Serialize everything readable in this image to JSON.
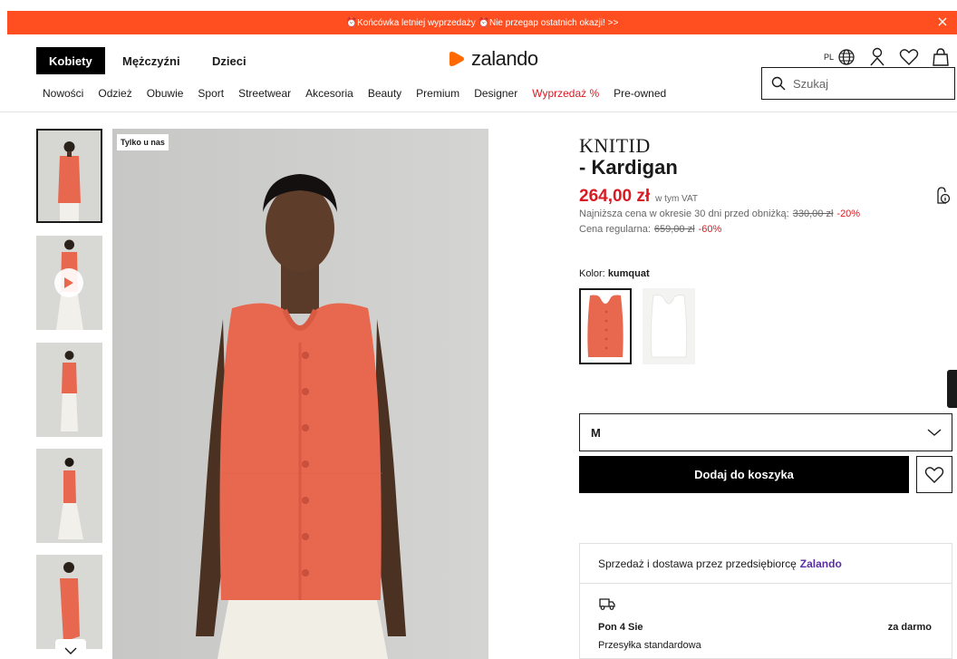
{
  "promo": {
    "text": "⏰Końcówka letniej wyprzedaży ⏰Nie przegap ostatnich okazji! >>"
  },
  "header": {
    "genders": [
      "Kobiety",
      "Mężczyźni",
      "Dzieci"
    ],
    "logo": "zalando",
    "lang": "PL",
    "categories": [
      "Nowości",
      "Odzież",
      "Obuwie",
      "Sport",
      "Streetwear",
      "Akcesoria",
      "Beauty",
      "Premium",
      "Designer",
      "Wyprzedaż %",
      "Pre-owned"
    ],
    "search_placeholder": "Szukaj"
  },
  "gallery": {
    "badge": "Tylko u nas",
    "thumb_count": 5
  },
  "product": {
    "brand": "KNITID",
    "name": "- Kardigan",
    "price": "264,00 zł",
    "vat": "w tym VAT",
    "lowest_label": "Najniższa cena w okresie 30 dni przed obniżką:",
    "lowest_price": "330,00 zł",
    "lowest_discount": "-20%",
    "regular_label": "Cena regularna:",
    "regular_price": "659,00 zł",
    "regular_discount": "-60%",
    "color_label": "Kolor:",
    "color_value": "kumquat",
    "size": "M",
    "add_to_cart": "Dodaj do koszyka"
  },
  "seller": {
    "text": "Sprzedaż i dostawa przez przedsiębiorcę",
    "name": "Zalando",
    "delivery_date": "Pon 4 Sie",
    "delivery_price": "za darmo",
    "delivery_type": "Przesyłka standardowa"
  },
  "colors": {
    "promo": "#ff4e1f",
    "sale_red": "#d91a23",
    "brand_orange": "#ff6900",
    "garment": "#e8674f",
    "seller_purple": "#5a2ea6"
  }
}
